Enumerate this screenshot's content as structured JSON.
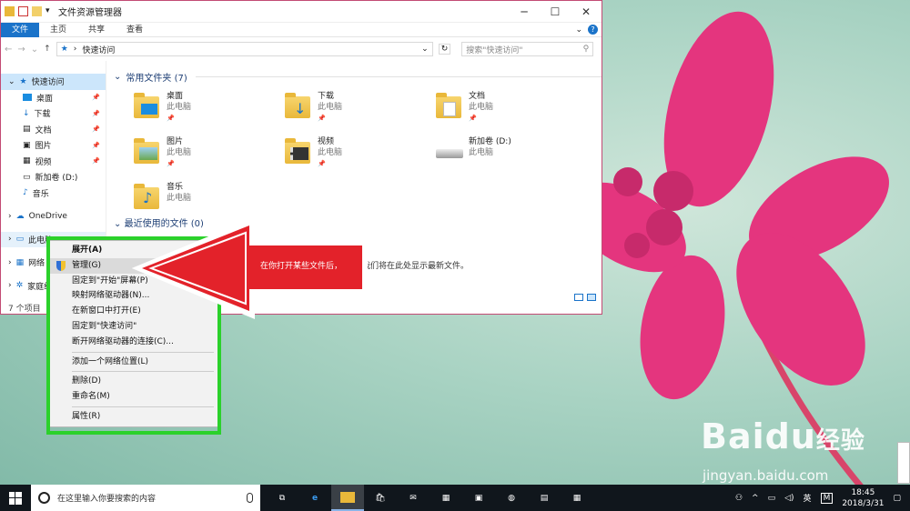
{
  "window": {
    "title": "文件资源管理器",
    "ribbon_tabs": [
      "文件",
      "主页",
      "共享",
      "查看"
    ],
    "path": "快速访问",
    "search_placeholder": "搜索\"快速访问\"",
    "status": "7 个项目"
  },
  "sidebar": {
    "items": [
      {
        "label": "快速访问",
        "pinned": false
      },
      {
        "label": "桌面",
        "pinned": true
      },
      {
        "label": "下载",
        "pinned": true
      },
      {
        "label": "文档",
        "pinned": true
      },
      {
        "label": "图片",
        "pinned": true
      },
      {
        "label": "视频",
        "pinned": true
      },
      {
        "label": "新加卷 (D:)",
        "pinned": false
      },
      {
        "label": "音乐",
        "pinned": false
      },
      {
        "label": "OneDrive",
        "pinned": false
      },
      {
        "label": "此电脑",
        "pinned": false
      },
      {
        "label": "网络",
        "pinned": false
      },
      {
        "label": "家庭组",
        "pinned": false
      }
    ]
  },
  "main": {
    "frequent_header": "常用文件夹 (7)",
    "recent_header": "最近使用的文件 (0)",
    "tiles": [
      {
        "name": "桌面",
        "sub": "此电脑",
        "icon": "desktop-folder-icon"
      },
      {
        "name": "下载",
        "sub": "此电脑",
        "icon": "downloads-folder-icon"
      },
      {
        "name": "文档",
        "sub": "此电脑",
        "icon": "documents-folder-icon"
      },
      {
        "name": "图片",
        "sub": "此电脑",
        "icon": "pictures-folder-icon"
      },
      {
        "name": "视频",
        "sub": "此电脑",
        "icon": "videos-folder-icon"
      },
      {
        "name": "新加卷 (D:)",
        "sub": "此电脑",
        "icon": "drive-icon"
      },
      {
        "name": "音乐",
        "sub": "此电脑",
        "icon": "music-folder-icon"
      }
    ],
    "recent_msg_part1": "在你打开某些文件后，",
    "recent_msg_part2": "我们将在此处显示最新文件。"
  },
  "context_menu": {
    "items": [
      "展开(A)",
      "管理(G)",
      "固定到\"开始\"屏幕(P)",
      "映射网络驱动器(N)...",
      "在新窗口中打开(E)",
      "固定到\"快速访问\"",
      "断开网络驱动器的连接(C)...",
      "添加一个网络位置(L)",
      "删除(D)",
      "重命名(M)",
      "属性(R)"
    ]
  },
  "taskbar": {
    "search_placeholder": "在这里输入你要搜索的内容",
    "ime": "英",
    "time": "18:45",
    "date": "2018/3/31"
  },
  "watermark": {
    "brand": "Bai",
    "brand_cn": "经验",
    "url": "jingyan.baidu.com"
  },
  "colors": {
    "accent": "#1a73c9",
    "highlight_box": "#2bd12b",
    "arrow": "#e3222a",
    "border": "#c24b74"
  }
}
